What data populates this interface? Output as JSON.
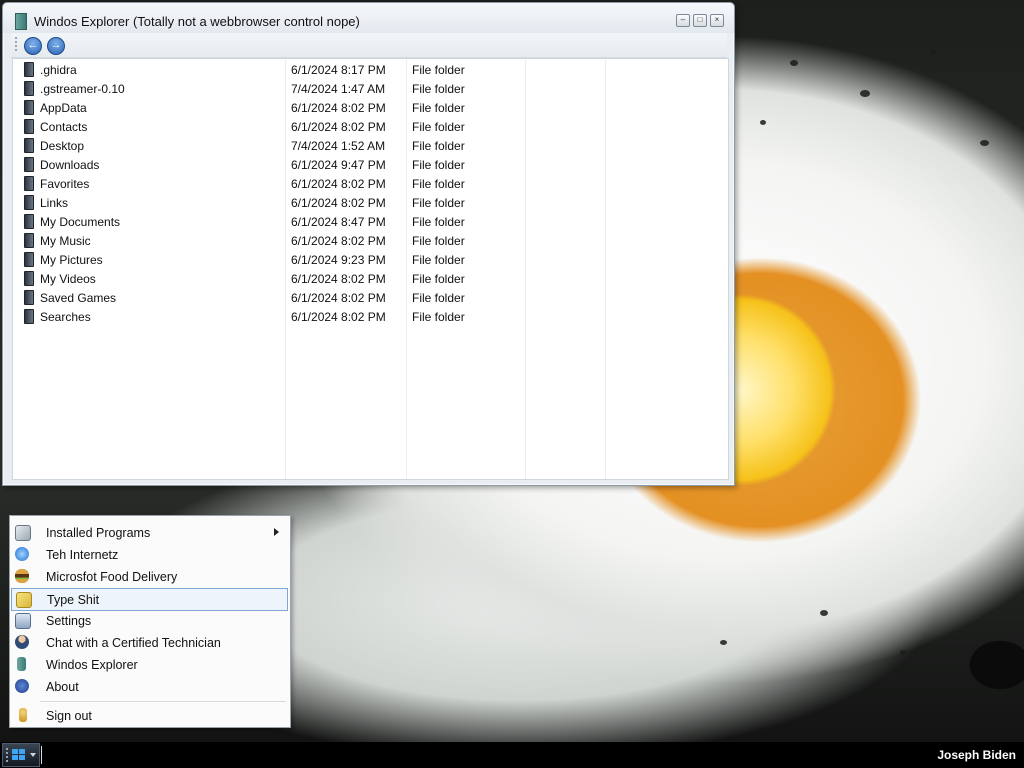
{
  "window": {
    "title": "Windos Explorer (Totally not a webbrowser control nope)",
    "nav": {
      "back_icon": "back-arrow-icon",
      "forward_icon": "forward-arrow-icon"
    },
    "caption_buttons": {
      "minimize": "–",
      "maximize": "□",
      "close": "×"
    }
  },
  "files": [
    {
      "name": ".ghidra",
      "date": "6/1/2024 8:17 PM",
      "type": "File folder"
    },
    {
      "name": ".gstreamer-0.10",
      "date": "7/4/2024 1:47 AM",
      "type": "File folder"
    },
    {
      "name": "AppData",
      "date": "6/1/2024 8:02 PM",
      "type": "File folder"
    },
    {
      "name": "Contacts",
      "date": "6/1/2024 8:02 PM",
      "type": "File folder"
    },
    {
      "name": "Desktop",
      "date": "7/4/2024 1:52 AM",
      "type": "File folder"
    },
    {
      "name": "Downloads",
      "date": "6/1/2024 9:47 PM",
      "type": "File folder"
    },
    {
      "name": "Favorites",
      "date": "6/1/2024 8:02 PM",
      "type": "File folder"
    },
    {
      "name": "Links",
      "date": "6/1/2024 8:02 PM",
      "type": "File folder"
    },
    {
      "name": "My Documents",
      "date": "6/1/2024 8:47 PM",
      "type": "File folder"
    },
    {
      "name": "My Music",
      "date": "6/1/2024 8:02 PM",
      "type": "File folder"
    },
    {
      "name": "My Pictures",
      "date": "6/1/2024 9:23 PM",
      "type": "File folder"
    },
    {
      "name": "My Videos",
      "date": "6/1/2024 8:02 PM",
      "type": "File folder"
    },
    {
      "name": "Saved Games",
      "date": "6/1/2024 8:02 PM",
      "type": "File folder"
    },
    {
      "name": "Searches",
      "date": "6/1/2024 8:02 PM",
      "type": "File folder"
    }
  ],
  "start_menu": {
    "items": [
      {
        "label": "Installed Programs",
        "icon": "programs-icon",
        "submenu": true
      },
      {
        "label": "Teh Internetz",
        "icon": "internet-explorer-icon"
      },
      {
        "label": "Microsfot Food Delivery",
        "icon": "burger-icon"
      },
      {
        "label": "Type Shit",
        "icon": "notepad-icon",
        "selected": true
      },
      {
        "label": "Settings",
        "icon": "settings-icon"
      },
      {
        "label": "Chat with a Certified Technician",
        "icon": "technician-icon"
      },
      {
        "label": "Windos Explorer",
        "icon": "explorer-icon"
      },
      {
        "label": "About",
        "icon": "help-icon"
      }
    ],
    "sign_out": {
      "label": "Sign out",
      "icon": "key-icon"
    }
  },
  "taskbar": {
    "start_icon": "windows-logo-icon",
    "user_name": "Joseph Biden"
  },
  "colors": {
    "selection_border": "#7fa7d6",
    "taskbar_bg": "#000000",
    "folder_icon": "#2c3440"
  }
}
